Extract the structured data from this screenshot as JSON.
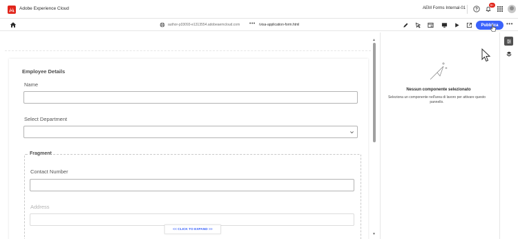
{
  "shell": {
    "product_name": "Adobe Experience Cloud",
    "org_name": "AEM Forms Internal-01",
    "notification_count": "9+"
  },
  "toolbar": {
    "url_host": "author-p33093-e1313554.adobeaemcloud.com",
    "url_more": "•••",
    "url_path": "/visa-application-form.html",
    "publish_label": "Pubblica",
    "more_label": "•••"
  },
  "form": {
    "section_title": "Employee Details",
    "name_label": "Name",
    "department_label": "Select Department",
    "fragment_title": "Fragment",
    "contact_label": "Contact Number",
    "address_label": "Address",
    "expand_label": "<< CLICK TO EXPAND >>"
  },
  "properties": {
    "empty_title": "Nessun componente selezionato",
    "empty_desc": "Seleziona un componente nell'area di lavoro per attivare questo pannello."
  },
  "colors": {
    "brand_red": "#e1251b",
    "accent_blue": "#3b63fb"
  },
  "icons": {
    "home": "home-icon",
    "globe": "globe-icon",
    "help": "help-icon",
    "bell": "bell-icon",
    "apps": "apps-grid-icon",
    "edit": "pencil-icon",
    "select": "select-pointer-icon",
    "properties": "properties-icon",
    "preview_device": "monitor-icon",
    "play": "play-icon",
    "open_external": "open-external-icon",
    "rail_properties": "properties-panel-icon",
    "rail_layers": "layers-icon"
  }
}
